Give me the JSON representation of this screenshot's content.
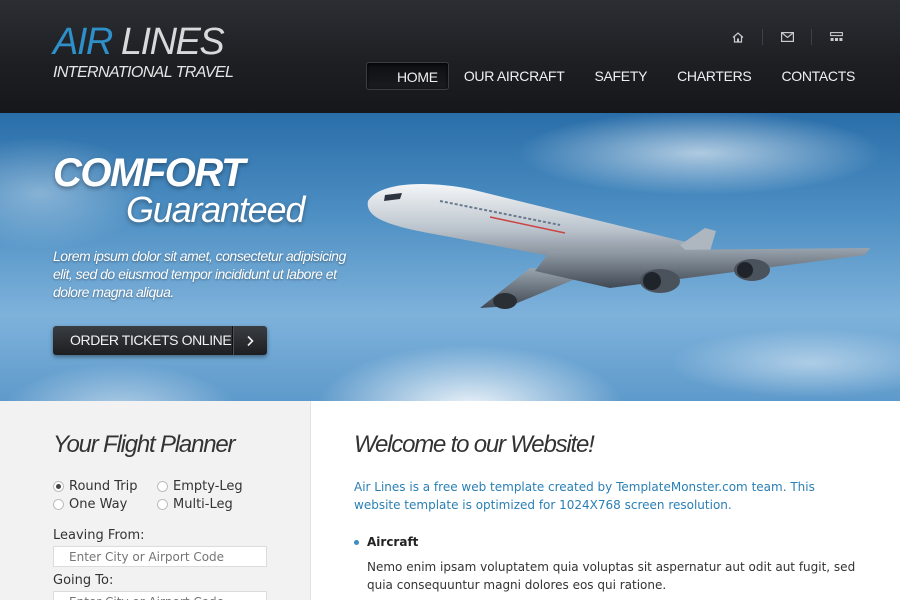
{
  "brand": {
    "logo_part1": "AIR",
    "logo_part2": " LINES",
    "tagline": "INTERNATIONAL TRAVEL"
  },
  "top_icons": [
    "home-icon",
    "mail-icon",
    "sitemap-icon"
  ],
  "nav": {
    "items": [
      {
        "label": "HOME",
        "active": true
      },
      {
        "label": "OUR AIRCRAFT",
        "active": false
      },
      {
        "label": "SAFETY",
        "active": false
      },
      {
        "label": "CHARTERS",
        "active": false
      },
      {
        "label": "CONTACTS",
        "active": false
      }
    ]
  },
  "hero": {
    "title": "COMFORT",
    "subtitle": "Guaranteed",
    "text": "Lorem ipsum dolor sit amet, consectetur adipisicing elit, sed do eiusmod tempor incididunt ut labore et dolore magna aliqua.",
    "button_label": "ORDER TICKETS ONLINE"
  },
  "planner": {
    "title": "Your Flight Planner",
    "trip_options": [
      {
        "label": "Round Trip",
        "selected": true
      },
      {
        "label": "Empty-Leg",
        "selected": false
      },
      {
        "label": "One Way",
        "selected": false
      },
      {
        "label": "Multi-Leg",
        "selected": false
      }
    ],
    "leaving_label": "Leaving From:",
    "leaving_placeholder": "Enter City or Airport Code",
    "going_label": "Going To:",
    "going_placeholder": "Enter City or Airport Code"
  },
  "main": {
    "welcome_title": "Welcome to our Website!",
    "intro": "Air Lines is a free web template created by TemplateMonster.com team. This website template is optimized for 1024X768 screen resolution.",
    "bullet_title": "Aircraft",
    "bullet_text": "Nemo enim ipsam voluptatem quia voluptas sit aspernatur aut odit aut fugit, sed quia consequuntur magni dolores eos qui ratione."
  },
  "colors": {
    "accent": "#2e8fc9",
    "header_bg": "#1d1f23",
    "link_text": "#2a7fb4"
  }
}
